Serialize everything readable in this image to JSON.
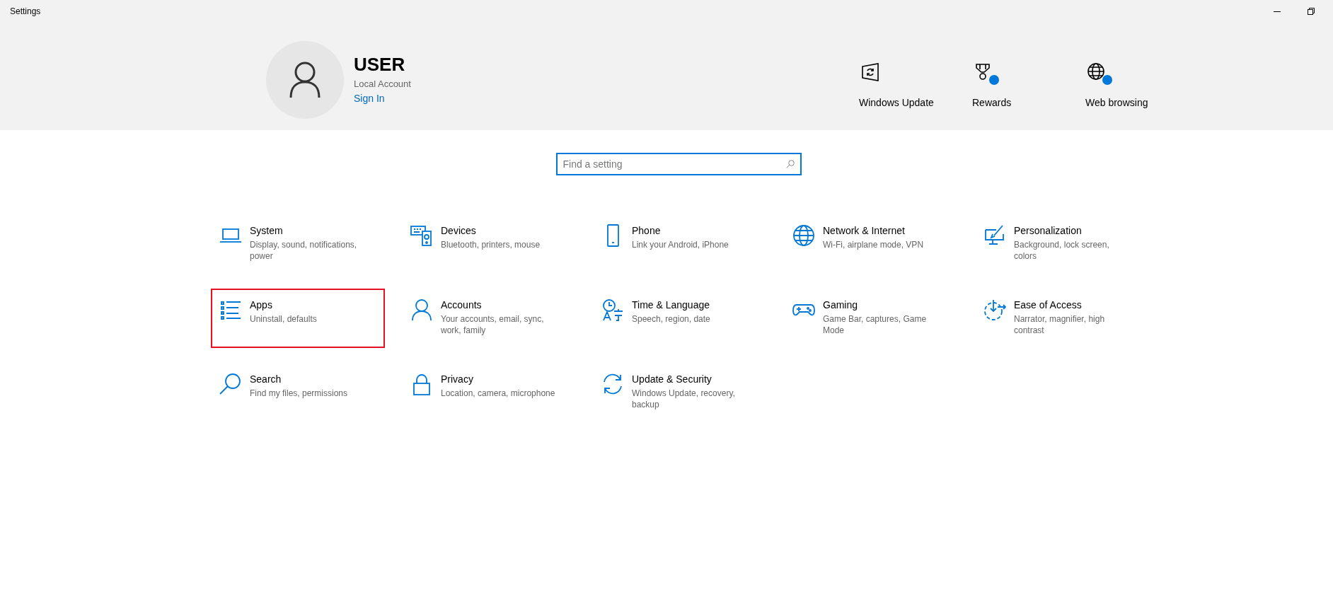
{
  "window": {
    "title": "Settings"
  },
  "account": {
    "name": "USER",
    "type": "Local Account",
    "sign_in": "Sign In"
  },
  "quick_links": [
    {
      "label": "Windows Update",
      "notification": false
    },
    {
      "label": "Rewards",
      "notification": true
    },
    {
      "label": "Web browsing",
      "notification": true
    }
  ],
  "search": {
    "placeholder": "Find a setting"
  },
  "categories": [
    {
      "title": "System",
      "description": "Display, sound, notifications, power",
      "highlighted": false
    },
    {
      "title": "Devices",
      "description": "Bluetooth, printers, mouse",
      "highlighted": false
    },
    {
      "title": "Phone",
      "description": "Link your Android, iPhone",
      "highlighted": false
    },
    {
      "title": "Network & Internet",
      "description": "Wi-Fi, airplane mode, VPN",
      "highlighted": false
    },
    {
      "title": "Personalization",
      "description": "Background, lock screen, colors",
      "highlighted": false
    },
    {
      "title": "Apps",
      "description": "Uninstall, defaults",
      "highlighted": true
    },
    {
      "title": "Accounts",
      "description": "Your accounts, email, sync, work, family",
      "highlighted": false
    },
    {
      "title": "Time & Language",
      "description": "Speech, region, date",
      "highlighted": false
    },
    {
      "title": "Gaming",
      "description": "Game Bar, captures, Game Mode",
      "highlighted": false
    },
    {
      "title": "Ease of Access",
      "description": "Narrator, magnifier, high contrast",
      "highlighted": false
    },
    {
      "title": "Search",
      "description": "Find my files, permissions",
      "highlighted": false
    },
    {
      "title": "Privacy",
      "description": "Location, camera, microphone",
      "highlighted": false
    },
    {
      "title": "Update & Security",
      "description": "Windows Update, recovery, backup",
      "highlighted": false
    }
  ]
}
